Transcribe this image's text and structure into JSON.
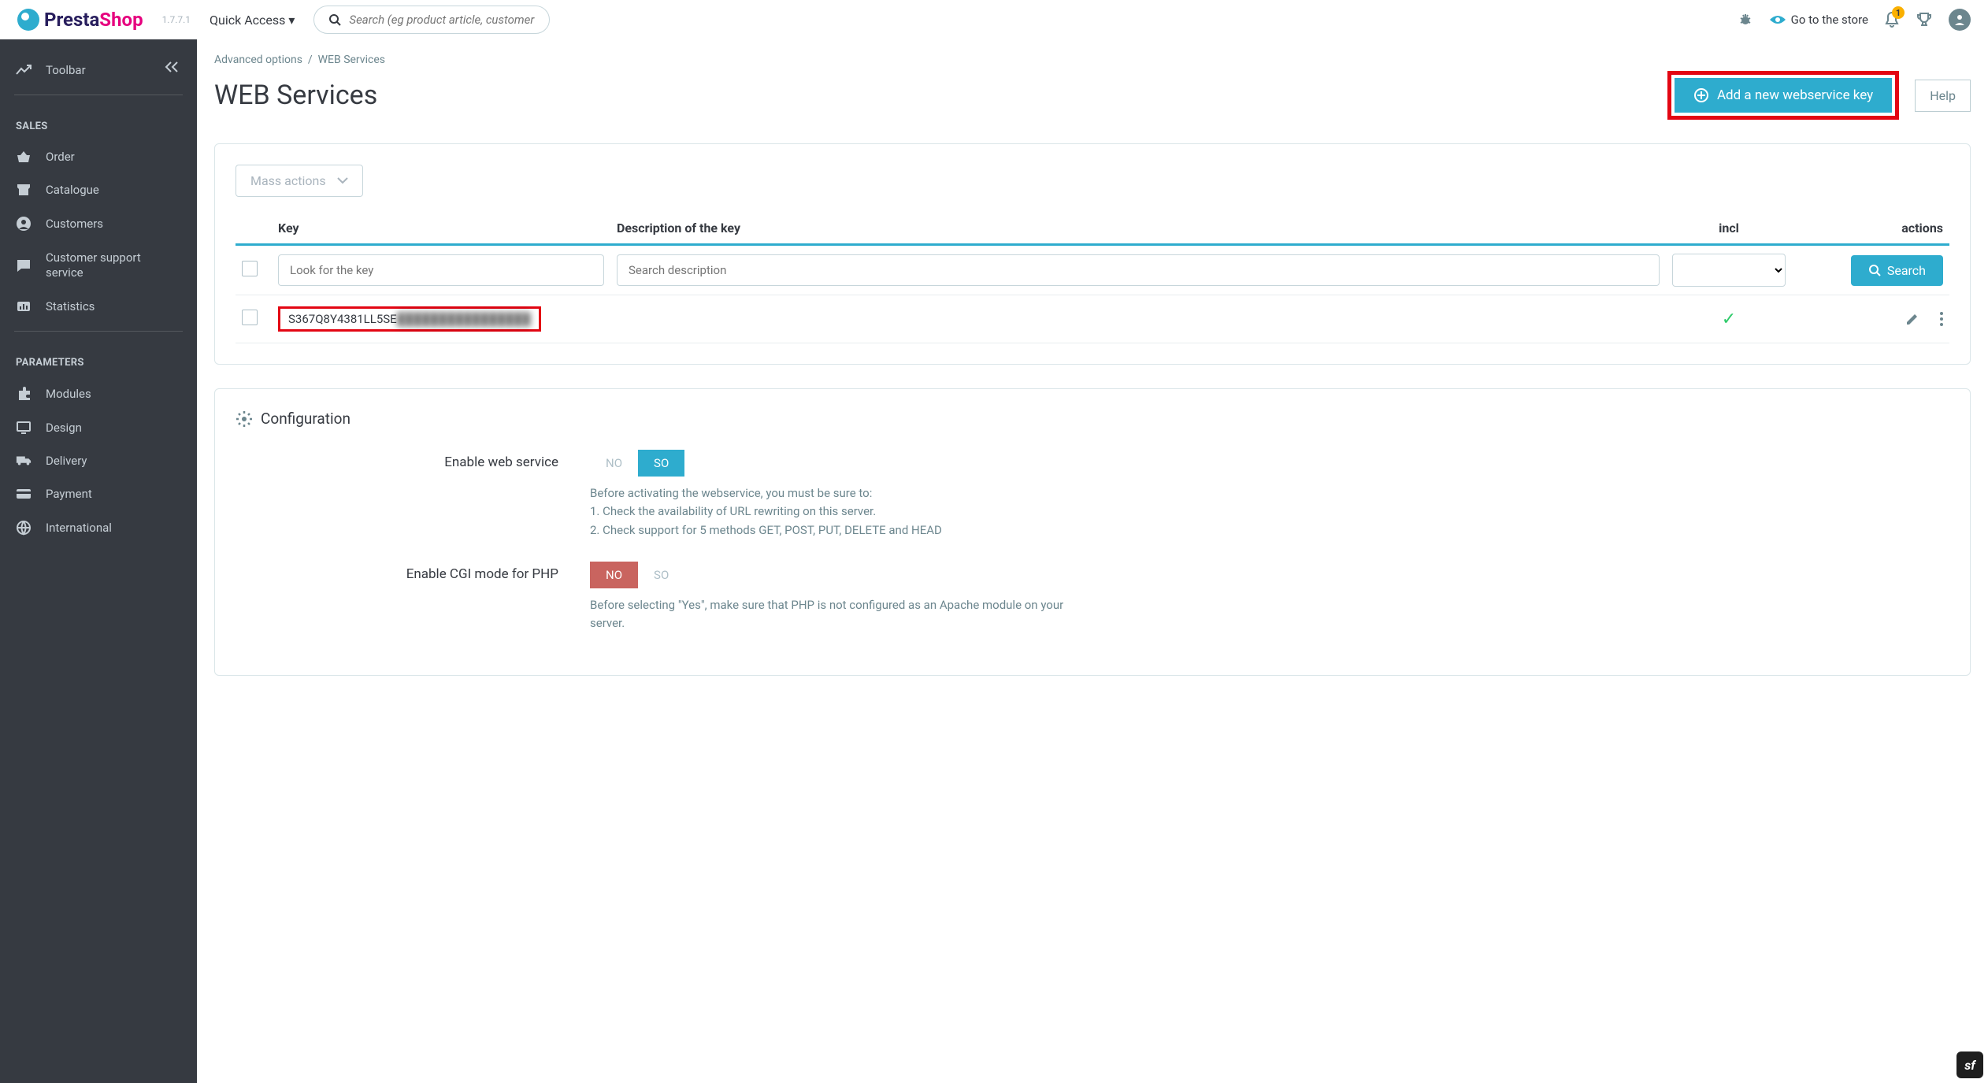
{
  "brand": {
    "name1": "Presta",
    "name2": "Shop",
    "version": "1.7.7.1"
  },
  "topbar": {
    "quick_access": "Quick Access",
    "search_placeholder": "Search (eg product article, customer name...)",
    "store_link": "Go to the store",
    "notif_count": "1"
  },
  "sidebar": {
    "toolbar": "Toolbar",
    "section_sales": "SALES",
    "section_params": "PARAMETERS",
    "items_sales": [
      "Order",
      "Catalogue",
      "Customers",
      "Customer support service",
      "Statistics"
    ],
    "items_params": [
      "Modules",
      "Design",
      "Delivery",
      "Payment",
      "International"
    ]
  },
  "page": {
    "crumb1": "Advanced options",
    "crumb2": "WEB Services",
    "title": "WEB Services",
    "add_btn": "Add a new webservice key",
    "help_btn": "Help"
  },
  "listing": {
    "mass_actions": "Mass actions",
    "col_key": "Key",
    "col_desc": "Description of the key",
    "col_incl": "incl",
    "col_actions": "actions",
    "ph_key": "Look for the key",
    "ph_desc": "Search description",
    "search_btn": "Search",
    "row_key_visible": "S367Q8Y4381LL5SE",
    "row_key_hidden": "████████████████"
  },
  "config": {
    "title": "Configuration",
    "row1_label": "Enable web service",
    "row2_label": "Enable CGI mode for PHP",
    "no": "NO",
    "so": "SO",
    "hint1a": "Before activating the webservice, you must be sure to:",
    "hint1b": "1. Check the availability of URL rewriting on this server.",
    "hint1c": "2. Check support for 5 methods GET, POST, PUT, DELETE and HEAD",
    "hint2": "Before selecting \"Yes\", make sure that PHP is not configured as an Apache module on your server."
  }
}
